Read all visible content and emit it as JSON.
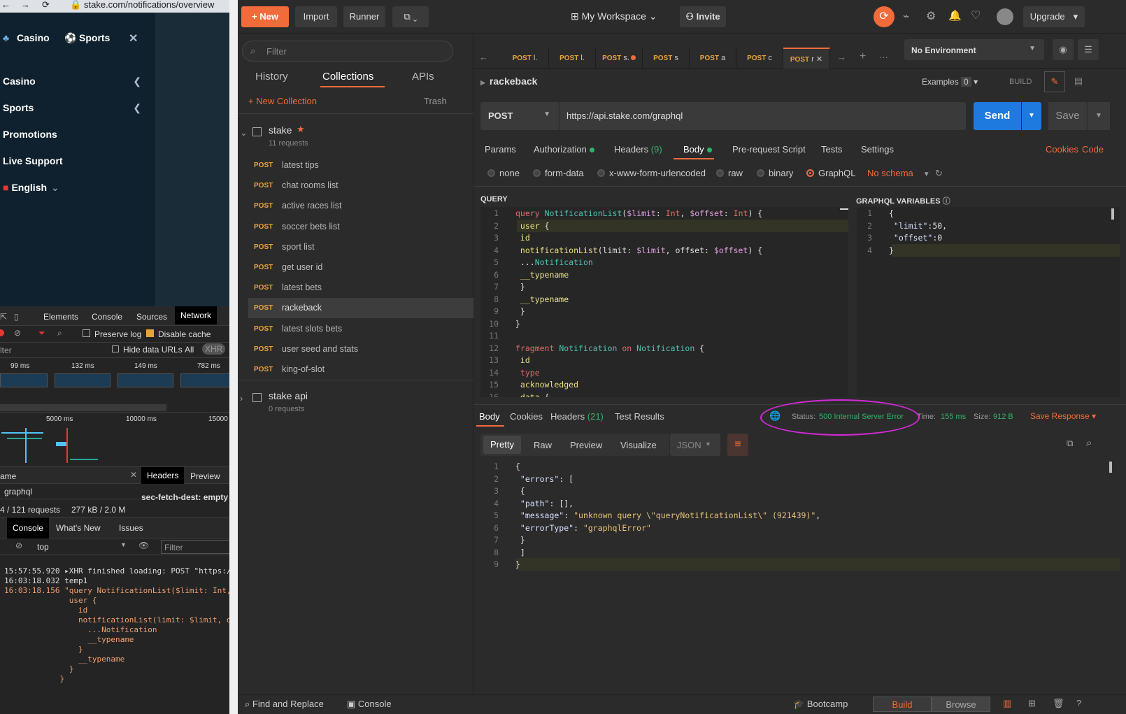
{
  "browser": {
    "url": "stake.com/notifications/overview",
    "stake_nav": {
      "casino_tab": "Casino",
      "sports_tab": "Sports",
      "items": [
        {
          "label": "Casino"
        },
        {
          "label": "Sports"
        },
        {
          "label": "Promotions"
        },
        {
          "label": "Live Support"
        },
        {
          "label": "English"
        }
      ]
    },
    "devtools": {
      "tabs": [
        "Elements",
        "Console",
        "Sources",
        "Network"
      ],
      "preserve_log": "Preserve log",
      "disable_cache": "Disable cache",
      "filter_label": "lter",
      "hide_data_urls": "Hide data URLs",
      "all": "All",
      "xhr": "XHR",
      "timeline_ticks": [
        "99 ms",
        "132 ms",
        "149 ms",
        "782 ms"
      ],
      "waterfall_ticks": [
        "5000 ms",
        "10000 ms",
        "15000"
      ],
      "name_col": "ame",
      "request_name": "graphql",
      "detail_tabs": [
        "Headers",
        "Preview"
      ],
      "header_line": "sec-fetch-dest: empty",
      "summary_requests": "4 / 121 requests",
      "summary_size": "277 kB / 2.0 M",
      "drawer_tabs": [
        "Console",
        "What's New",
        "Issues"
      ],
      "context": "top",
      "console_filter_placeholder": "Filter",
      "console_lines": [
        "15:57:55.920 ▸XHR finished loading: POST \"https:/",
        "16:03:18.032 temp1",
        "16:03:18.156 \"query NotificationList($limit: Int,",
        "              user {",
        "                id",
        "                notificationList(limit: $limit, o",
        "                  ...Notification",
        "                  __typename",
        "                }",
        "                __typename",
        "              }",
        "            }"
      ]
    }
  },
  "postman": {
    "toolbar": {
      "new": "New",
      "import": "Import",
      "runner": "Runner",
      "workspace": "My Workspace",
      "invite": "Invite",
      "upgrade": "Upgrade"
    },
    "sidebar": {
      "filter_placeholder": "Filter",
      "tabs": [
        "History",
        "Collections",
        "APIs"
      ],
      "new_collection": "New Collection",
      "trash": "Trash",
      "collections": [
        {
          "name": "stake",
          "count": "11 requests"
        },
        {
          "name": "stake api",
          "count": "0 requests"
        }
      ],
      "requests": [
        {
          "method": "POST",
          "name": "latest tips"
        },
        {
          "method": "POST",
          "name": "chat rooms list"
        },
        {
          "method": "POST",
          "name": "active races list"
        },
        {
          "method": "POST",
          "name": "soccer bets list"
        },
        {
          "method": "POST",
          "name": "sport list"
        },
        {
          "method": "POST",
          "name": "get user id"
        },
        {
          "method": "POST",
          "name": "latest bets"
        },
        {
          "method": "POST",
          "name": "rackeback"
        },
        {
          "method": "POST",
          "name": "latest slots bets"
        },
        {
          "method": "POST",
          "name": "user seed and stats"
        },
        {
          "method": "POST",
          "name": "king-of-slot"
        }
      ]
    },
    "tabs": [
      {
        "method": "POST",
        "name": "l."
      },
      {
        "method": "POST",
        "name": "l."
      },
      {
        "method": "POST",
        "name": "s."
      },
      {
        "method": "POST",
        "name": "s"
      },
      {
        "method": "POST",
        "name": "a"
      },
      {
        "method": "POST",
        "name": "c"
      },
      {
        "method": "POST",
        "name": "r"
      }
    ],
    "environment": "No Environment",
    "request_name": "rackeback",
    "examples_label": "Examples",
    "examples_count": "0",
    "build_label": "BUILD",
    "method": "POST",
    "url": "https://api.stake.com/graphql",
    "send": "Send",
    "save": "Save",
    "req_tabs": {
      "params": "Params",
      "authorization": "Authorization",
      "headers": "Headers",
      "headers_count": "(9)",
      "body": "Body",
      "pre_request": "Pre-request Script",
      "tests": "Tests",
      "settings": "Settings",
      "cookies": "Cookies",
      "code": "Code"
    },
    "body_types": [
      "none",
      "form-data",
      "x-www-form-urlencoded",
      "raw",
      "binary",
      "GraphQL"
    ],
    "no_schema": "No schema",
    "query_label": "QUERY",
    "variables_label": "GRAPHQL VARIABLES",
    "response": {
      "tabs": {
        "body": "Body",
        "cookies": "Cookies",
        "headers": "Headers",
        "headers_count": "(21)",
        "tests": "Test Results"
      },
      "status_label": "Status:",
      "status_value": "500 Internal Server Error",
      "time_label": "Time:",
      "time_value": "155 ms",
      "size_label": "Size:",
      "size_value": "912 B",
      "save_response": "Save Response",
      "view_tabs": [
        "Pretty",
        "Raw",
        "Preview",
        "Visualize"
      ],
      "format": "JSON"
    },
    "bottom": {
      "find_replace": "Find and Replace",
      "console": "Console",
      "bootcamp": "Bootcamp",
      "build": "Build",
      "browse": "Browse"
    },
    "colors": {
      "accent": "#f26b3a",
      "send_blue": "#1f7ae0",
      "status_green": "#2fb36b",
      "annotation": "#d42ad8"
    }
  }
}
